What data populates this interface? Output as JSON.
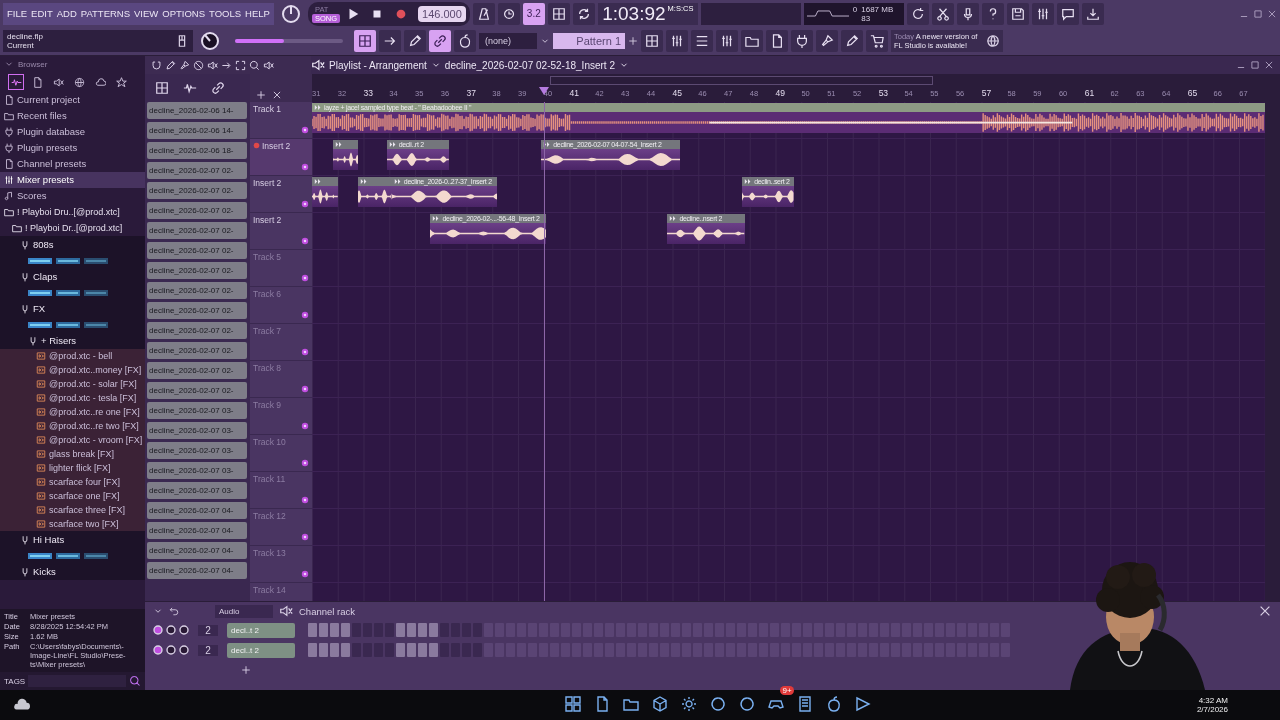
{
  "menu": [
    "FILE",
    "EDIT",
    "ADD",
    "PATTERNS",
    "VIEW",
    "OPTIONS",
    "TOOLS",
    "HELP"
  ],
  "hint": {
    "file": "decline.flp",
    "label": "Current"
  },
  "transport": {
    "modes": [
      {
        "label": "PAT",
        "selected": false
      },
      {
        "label": "SONG",
        "selected": true
      }
    ],
    "tempo": "146.000"
  },
  "toolbar_1": [
    {
      "on": false
    },
    {
      "on": false
    },
    {
      "label": "3.2",
      "on": true
    },
    {
      "on": false
    },
    {
      "on": false
    }
  ],
  "toolbar_2": [
    {
      "on": true
    },
    {
      "on": false
    },
    {
      "on": false
    },
    {
      "on": true
    },
    {
      "on": false
    }
  ],
  "master_pitch": {
    "level": 0.45
  },
  "clock": {
    "time": "1:03:92",
    "unit": "M:S:CS"
  },
  "cpu": {
    "voices": "0",
    "memory": "1687 MB",
    "polyphony": "83"
  },
  "snap": "(none)",
  "pattern": "Pattern 1",
  "news": {
    "when": "Today",
    "message": "A newer version of FL Studio is available!"
  },
  "browser": {
    "title": "Browser",
    "tabs": [
      {
        "selected": true
      },
      {
        "selected": false
      },
      {
        "selected": false
      },
      {
        "selected": false
      },
      {
        "selected": false
      },
      {
        "selected": false
      }
    ],
    "items": [
      {
        "label": "Current project",
        "kind": "location",
        "selected": false
      },
      {
        "label": "Recent files",
        "kind": "location",
        "selected": false
      },
      {
        "label": "Plugin database",
        "kind": "location",
        "selected": false
      },
      {
        "label": "Plugin presets",
        "kind": "location",
        "selected": false
      },
      {
        "label": "Channel presets",
        "kind": "location",
        "selected": false
      },
      {
        "label": "Mixer presets",
        "kind": "location",
        "selected": true
      },
      {
        "label": "Scores",
        "kind": "location",
        "selected": false
      },
      {
        "label": "! Playboi Dru..[@prod.xtc]",
        "kind": "folder",
        "selected": false,
        "children": [
          {
            "label": "! Playboi Dr..[@prod.xtc]",
            "kind": "folder",
            "selected": false,
            "children": [
              {
                "label": "808s",
                "kind": "sample_folder",
                "selected": false,
                "children": [
                  {
                    "kind": "picture"
                  }
                ]
              },
              {
                "label": "Claps",
                "kind": "sample_folder",
                "selected": false,
                "children": [
                  {
                    "kind": "picture"
                  }
                ]
              },
              {
                "label": "FX",
                "kind": "sample_folder",
                "selected": false,
                "children": [
                  {
                    "kind": "picture"
                  },
                  {
                    "label": "+ Risers",
                    "kind": "sample_folder",
                    "selected": false,
                    "children": [
                      {
                        "label": "@prod.xtc - bell",
                        "kind": "file",
                        "selected": false
                      },
                      {
                        "label": "@prod.xtc..money [FX]",
                        "kind": "file",
                        "selected": false
                      },
                      {
                        "label": "@prod.xtc - solar [FX]",
                        "kind": "file",
                        "selected": false
                      },
                      {
                        "label": "@prod.xtc - tesla [FX]",
                        "kind": "file",
                        "selected": false
                      },
                      {
                        "label": "@prod.xtc..re one [FX]",
                        "kind": "file",
                        "selected": false
                      },
                      {
                        "label": "@prod.xtc..re two [FX]",
                        "kind": "file",
                        "selected": false
                      },
                      {
                        "label": "@prod.xtc - vroom [FX]",
                        "kind": "file",
                        "selected": false
                      },
                      {
                        "label": "glass break [FX]",
                        "kind": "file",
                        "selected": false
                      },
                      {
                        "label": "lighter flick [FX]",
                        "kind": "file",
                        "selected": false
                      },
                      {
                        "label": "scarface four [FX]",
                        "kind": "file",
                        "selected": false
                      },
                      {
                        "label": "scarface one [FX]",
                        "kind": "file",
                        "selected": false
                      },
                      {
                        "label": "scarface three [FX]",
                        "kind": "file",
                        "selected": false
                      },
                      {
                        "label": "scarface two [FX]",
                        "kind": "file",
                        "selected": false
                      }
                    ]
                  }
                ]
              },
              {
                "label": "Hi Hats",
                "kind": "sample_folder",
                "selected": false,
                "children": [
                  {
                    "kind": "picture"
                  }
                ]
              },
              {
                "label": "Kicks",
                "kind": "sample_folder",
                "selected": false
              }
            ]
          }
        ]
      }
    ]
  },
  "info": {
    "fields": [
      {
        "label": "Title",
        "value": "Mixer presets"
      },
      {
        "label": "Date",
        "value": "8/28/2025 12:54:42 PM"
      },
      {
        "label": "Size",
        "value": "1.62 MB"
      }
    ],
    "path_label": "Path",
    "path_lines": [
      "C:\\Users\\fabys\\Documents\\-",
      "Image-Line\\FL Studio\\Prese-",
      "ts\\Mixer presets\\"
    ],
    "tags": "TAGS"
  },
  "patterns": [
    "decline_2026-02-06 14-",
    "decline_2026-02-06 14-",
    "decline_2026-02-06 18-",
    "decline_2026-02-07 02-",
    "decline_2026-02-07 02-",
    "decline_2026-02-07 02-",
    "decline_2026-02-07 02-",
    "decline_2026-02-07 02-",
    "decline_2026-02-07 02-",
    "decline_2026-02-07 02-",
    "decline_2026-02-07 02-",
    "decline_2026-02-07 02-",
    "decline_2026-02-07 02-",
    "decline_2026-02-07 02-",
    "decline_2026-02-07 02-",
    "decline_2026-02-07 03-",
    "decline_2026-02-07 03-",
    "decline_2026-02-07 03-",
    "decline_2026-02-07 03-",
    "decline_2026-02-07 03-",
    "decline_2026-02-07 04-",
    "decline_2026-02-07 04-",
    "decline_2026-02-07 04-",
    "decline_2026-02-07 04-"
  ],
  "playlist": {
    "title": "Playlist - Arrangement",
    "clip": "decline_2026-02-07 02-52-18_Insert 2",
    "bars": [
      "31",
      "32",
      "33",
      "34",
      "35",
      "36",
      "37",
      "38",
      "39",
      "40",
      "41",
      "42",
      "43",
      "44",
      "45",
      "46",
      "47",
      "48",
      "49",
      "50",
      "51",
      "52",
      "53",
      "54",
      "55",
      "56",
      "57",
      "58",
      "59",
      "60",
      "61",
      "62",
      "63",
      "64",
      "65",
      "66",
      "67"
    ],
    "tracks": [
      {
        "name": "Track 1",
        "record_armed": false,
        "clips": [
          {
            "kind": "song",
            "label": "iayze + jace! sampled type beat - \" Beabadoobee II \""
          }
        ]
      },
      {
        "name": "Insert 2",
        "record_armed": true,
        "clips": [
          {
            "kind": "audio"
          },
          {
            "kind": "audio",
            "label": "decli..rt 2"
          },
          {
            "kind": "audio",
            "label": "decline_2026-02-07 04-07-54_Insert 2"
          }
        ]
      },
      {
        "name": "Insert 2",
        "record_armed": false,
        "clips": [
          {
            "kind": "audio"
          },
          {
            "kind": "audio"
          },
          {
            "kind": "audio",
            "label": "decline_2026-0..27-37_Insert 2"
          },
          {
            "kind": "audio",
            "label": "declin..sert 2"
          }
        ]
      },
      {
        "name": "Insert 2",
        "record_armed": false,
        "clips": [
          {
            "kind": "audio",
            "label": "decline_2026-02-...-56-48_Insert 2"
          },
          {
            "kind": "audio",
            "label": "decline..nsert 2"
          }
        ]
      },
      {
        "name": "Track 5",
        "record_armed": false
      },
      {
        "name": "Track 6",
        "record_armed": false
      },
      {
        "name": "Track 7",
        "record_armed": false
      },
      {
        "name": "Track 8",
        "record_armed": false
      },
      {
        "name": "Track 9",
        "record_armed": false
      },
      {
        "name": "Track 10",
        "record_armed": false
      },
      {
        "name": "Track 11",
        "record_armed": false
      },
      {
        "name": "Track 12",
        "record_armed": false
      },
      {
        "name": "Track 13",
        "record_armed": false
      },
      {
        "name": "Track 14",
        "record_armed": false
      }
    ]
  },
  "channel_rack": {
    "filter": "Audio",
    "title": "Channel rack",
    "channels": [
      {
        "mixer": "2",
        "name": "decl..t 2"
      },
      {
        "mixer": "2",
        "name": "decl..t 2"
      }
    ]
  },
  "taskbar": {
    "badge": "9+",
    "time": "4:32 AM",
    "date": "2/7/2026"
  }
}
